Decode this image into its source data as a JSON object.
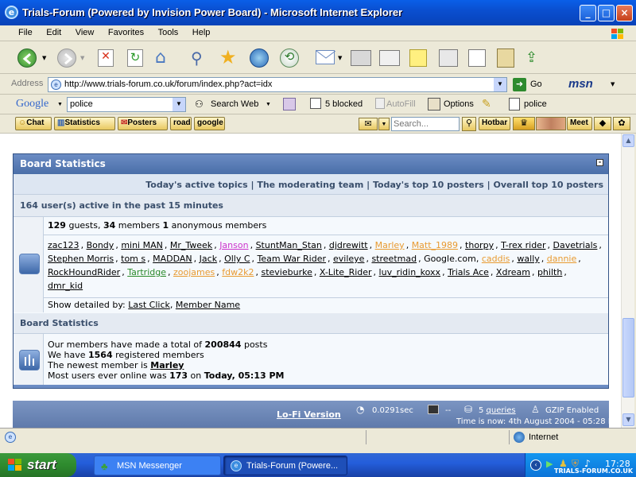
{
  "window": {
    "title": "Trials-Forum (Powered by Invision Power Board) - Microsoft Internet Explorer"
  },
  "menu": [
    "File",
    "Edit",
    "View",
    "Favorites",
    "Tools",
    "Help"
  ],
  "address": {
    "label": "Address",
    "url": "http://www.trials-forum.co.uk/forum/index.php?act=idx",
    "go": "Go",
    "msn": "msn"
  },
  "google": {
    "label": "Google",
    "query": "police",
    "search_web": "Search Web",
    "blocked": "5 blocked",
    "autofill": "AutoFill",
    "options": "Options",
    "highlight": "police"
  },
  "links": {
    "items": [
      "Chat",
      "Statistics",
      "Posters",
      "road",
      "google"
    ],
    "search_placeholder": "Search...",
    "hotbar": "Hotbar",
    "meet": "Meet"
  },
  "forum": {
    "title": "Board Statistics",
    "cat_links": "Today's active topics | The moderating team | Today's top 10 posters | Overall top 10 posters",
    "active_header": "164 user(s) active in the past 15 minutes",
    "guests_count": "129",
    "guests_text": " guests, ",
    "members_count": "34",
    "members_text": " members ",
    "anon_count": "1",
    "anon_text": " anonymous members",
    "users": [
      {
        "name": "zac123",
        "color": "#000000"
      },
      {
        "name": "Bondy",
        "color": "#000000"
      },
      {
        "name": "mini MAN",
        "color": "#000000"
      },
      {
        "name": "Mr_Tweek",
        "color": "#000000"
      },
      {
        "name": "Janson",
        "color": "#cc33cc"
      },
      {
        "name": "StuntMan_Stan",
        "color": "#000000"
      },
      {
        "name": "djdrewitt",
        "color": "#000000"
      },
      {
        "name": "Marley",
        "color": "#e89a30"
      },
      {
        "name": "Matt_1989",
        "color": "#e89a30"
      },
      {
        "name": "thorpy",
        "color": "#000000"
      },
      {
        "name": "T-rex rider",
        "color": "#000000"
      },
      {
        "name": "Davetrials",
        "color": "#000000"
      },
      {
        "name": "Stephen Morris",
        "color": "#000000"
      },
      {
        "name": "tom s",
        "color": "#000000"
      },
      {
        "name": "MADDAN",
        "color": "#000000"
      },
      {
        "name": "Jack",
        "color": "#000000"
      },
      {
        "name": "Olly C",
        "color": "#000000"
      },
      {
        "name": "Team War Rider",
        "color": "#000000"
      },
      {
        "name": "evileye",
        "color": "#000000"
      },
      {
        "name": "streetmad",
        "color": "#000000"
      },
      {
        "name": "Google.com",
        "color": "#000000",
        "plain": true
      },
      {
        "name": "caddis",
        "color": "#e89a30"
      },
      {
        "name": "wally",
        "color": "#000000"
      },
      {
        "name": "dannie",
        "color": "#e89a30"
      },
      {
        "name": "RockHoundRider",
        "color": "#000000"
      },
      {
        "name": "Tartridge",
        "color": "#2a8a2a"
      },
      {
        "name": "zoojames",
        "color": "#e89a30"
      },
      {
        "name": "fdw2k2",
        "color": "#e89a30"
      },
      {
        "name": "stevieburke",
        "color": "#000000"
      },
      {
        "name": "X-Lite_Rider",
        "color": "#000000"
      },
      {
        "name": "luv_ridin_koxx",
        "color": "#000000"
      },
      {
        "name": "Trials Ace",
        "color": "#000000"
      },
      {
        "name": "Xdream",
        "color": "#000000"
      },
      {
        "name": "philth",
        "color": "#000000"
      },
      {
        "name": "dmr_kid",
        "color": "#000000"
      }
    ],
    "show_detailed": "Show detailed by:",
    "last_click": "Last Click",
    "member_name": "Member Name",
    "stats_header": "Board Statistics",
    "posts_prefix": "Our members have made a total of ",
    "posts_count": "200844",
    "posts_suffix": " posts",
    "registered_prefix": "We have ",
    "registered_count": "1564",
    "registered_suffix": " registered members",
    "newest_prefix": "The newest member is ",
    "newest_member": "Marley",
    "most_prefix": "Most users ever online was ",
    "most_count": "173",
    "most_on": " on ",
    "most_date": "Today, 05:13 PM"
  },
  "footer": {
    "lofi": "Lo-Fi Version",
    "time": "0.0291sec",
    "dash": "--",
    "queries_prefix": "5 ",
    "queries": "queries",
    "gzip": "GZIP Enabled",
    "now": "Time is now: 4th August 2004 - 05:28 PM"
  },
  "status": {
    "zone": "Internet"
  },
  "taskbar": {
    "start": "start",
    "tasks": [
      "MSN Messenger",
      "Trials-Forum (Powere..."
    ],
    "clock": "17:28",
    "watermark": "TRIALS-FORUM.CO.UK"
  }
}
